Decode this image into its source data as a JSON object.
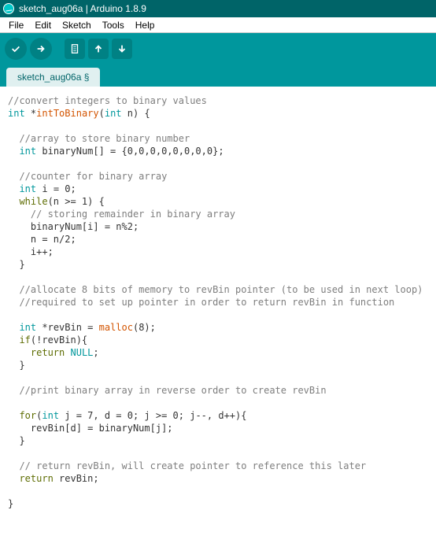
{
  "window": {
    "title": "sketch_aug06a | Arduino 1.8.9"
  },
  "menu": {
    "items": [
      "File",
      "Edit",
      "Sketch",
      "Tools",
      "Help"
    ]
  },
  "toolbar": {
    "verify": "verify",
    "upload": "upload",
    "new": "new",
    "open": "open",
    "save": "save"
  },
  "tabs": {
    "active": "sketch_aug06a §"
  },
  "code": {
    "l1_comment": "//convert integers to binary values",
    "l2_a": "int",
    "l2_b": " *",
    "l2_c": "intToBinary",
    "l2_d": "(",
    "l2_e": "int",
    "l2_f": " n) {",
    "l3_comment": "  //array to store binary number",
    "l4_a": "  ",
    "l4_b": "int",
    "l4_c": " binaryNum[] = {0,0,0,0,0,0,0,0};",
    "l5_comment": "  //counter for binary array",
    "l6_a": "  ",
    "l6_b": "int",
    "l6_c": " i = 0;",
    "l7_a": "  ",
    "l7_b": "while",
    "l7_c": "(n >= 1) {",
    "l8_comment": "    // storing remainder in binary array",
    "l9": "    binaryNum[i] = n%2;",
    "l10": "    n = n/2;",
    "l11": "    i++;",
    "l12": "  }",
    "l13_comment": "  //allocate 8 bits of memory to revBin pointer (to be used in next loop)",
    "l14_comment": "  //required to set up pointer in order to return revBin in function",
    "l15_a": "  ",
    "l15_b": "int",
    "l15_c": " *revBin = ",
    "l15_d": "malloc",
    "l15_e": "(8);",
    "l16_a": "  ",
    "l16_b": "if",
    "l16_c": "(!revBin){",
    "l17_a": "    ",
    "l17_b": "return",
    "l17_c": " ",
    "l17_d": "NULL",
    "l17_e": ";",
    "l18": "  }",
    "l19_comment": "  //print binary array in reverse order to create revBin",
    "l20_a": "  ",
    "l20_b": "for",
    "l20_c": "(",
    "l20_d": "int",
    "l20_e": " j = 7, d = 0; j >= 0; j--, d++){",
    "l21": "    revBin[d] = binaryNum[j];",
    "l22": "  }",
    "l23_comment": "  // return revBin, will create pointer to reference this later",
    "l24_a": "  ",
    "l24_b": "return",
    "l24_c": " revBin;",
    "l25": "}"
  }
}
